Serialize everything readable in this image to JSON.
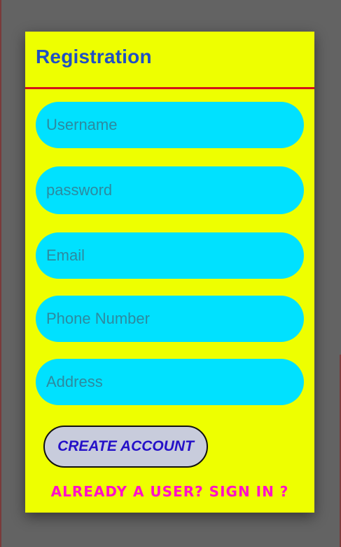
{
  "dialog": {
    "title": "Registration",
    "fields": {
      "username_placeholder": "Username",
      "password_placeholder": "password",
      "email_placeholder": "Email",
      "phone_placeholder": "Phone Number",
      "address_placeholder": "Address"
    },
    "create_label": "CREATE ACCOUNT",
    "signin_label": "ALREADY A USER? SIGN IN ?"
  },
  "colors": {
    "background": "#636363",
    "dialog_bg": "#eeff00",
    "title": "#1f4fc4",
    "divider": "#d4141a",
    "field_bg": "#00e1ff",
    "button_bg": "#c8ccdc",
    "button_text": "#2410c8",
    "link": "#ff10c8"
  }
}
